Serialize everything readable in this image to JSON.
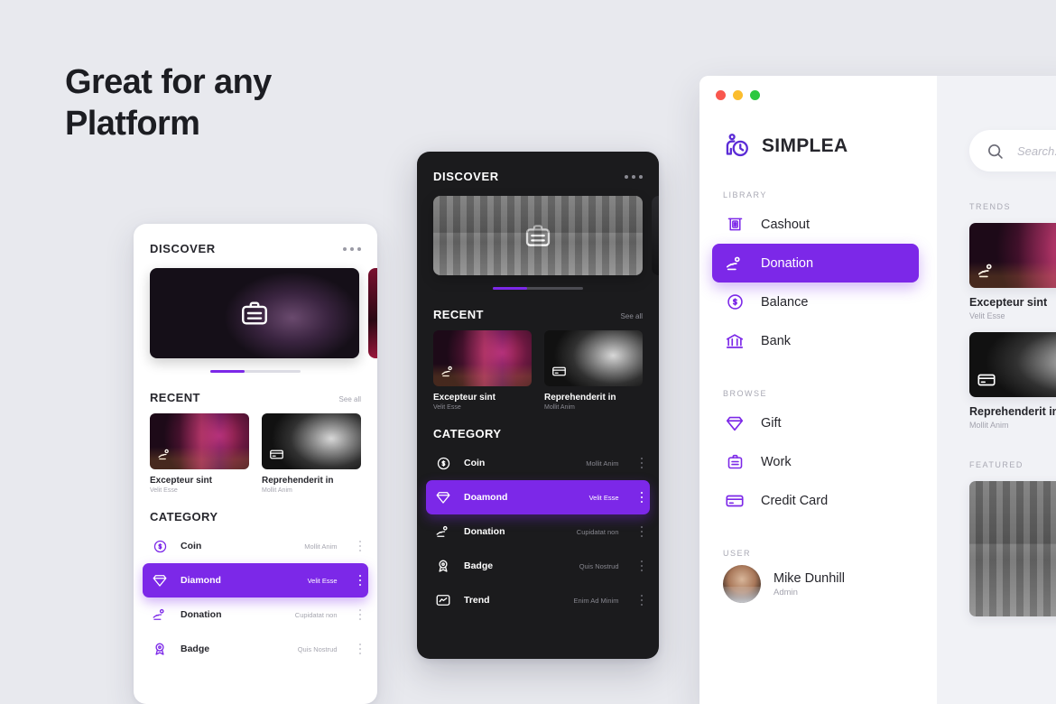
{
  "headline": {
    "line1": "Great for any",
    "line2": "Platform"
  },
  "phone_light": {
    "discover": {
      "title": "DISCOVER",
      "menu_icon": "more-horizontal-icon",
      "hero_icon": "briefcase-icon"
    },
    "recent": {
      "title": "RECENT",
      "see_all": "See all",
      "cards": [
        {
          "title": "Excepteur sint",
          "subtitle": "Velit Esse",
          "icon": "donation-icon"
        },
        {
          "title": "Reprehenderit in",
          "subtitle": "Mollit Anim",
          "icon": "credit-card-icon"
        }
      ]
    },
    "category": {
      "title": "CATEGORY",
      "items": [
        {
          "label": "Coin",
          "meta": "Mollit Anim",
          "icon": "coin-icon",
          "active": false
        },
        {
          "label": "Diamond",
          "meta": "Velit Esse",
          "icon": "diamond-icon",
          "active": true
        },
        {
          "label": "Donation",
          "meta": "Cupidatat non",
          "icon": "donation-icon",
          "active": false
        },
        {
          "label": "Badge",
          "meta": "Quis Nostrud",
          "icon": "badge-icon",
          "active": false
        }
      ]
    }
  },
  "phone_dark": {
    "discover": {
      "title": "DISCOVER",
      "menu_icon": "more-horizontal-icon",
      "hero_icon": "briefcase-icon"
    },
    "recent": {
      "title": "RECENT",
      "see_all": "See all",
      "cards": [
        {
          "title": "Excepteur sint",
          "subtitle": "Velit Esse",
          "icon": "donation-icon"
        },
        {
          "title": "Reprehenderit in",
          "subtitle": "Mollit Anim",
          "icon": "credit-card-icon"
        }
      ]
    },
    "category": {
      "title": "CATEGORY",
      "items": [
        {
          "label": "Coin",
          "meta": "Mollit Anim",
          "icon": "coin-icon",
          "active": false
        },
        {
          "label": "Doamond",
          "meta": "Velit Esse",
          "icon": "diamond-icon",
          "active": true
        },
        {
          "label": "Donation",
          "meta": "Cupidatat non",
          "icon": "donation-icon",
          "active": false
        },
        {
          "label": "Badge",
          "meta": "Quis Nostrud",
          "icon": "badge-icon",
          "active": false
        },
        {
          "label": "Trend",
          "meta": "Enim Ad Minim",
          "icon": "trend-icon",
          "active": false
        }
      ]
    }
  },
  "desktop": {
    "window_controls": {
      "close": "#f9574e",
      "minimize": "#fbbd2e",
      "maximize": "#2cc840"
    },
    "brand": {
      "name": "SIMPLEA",
      "logo_icon": "person-clock-icon"
    },
    "sections": [
      {
        "caption": "LIBRARY",
        "items": [
          {
            "label": "Cashout",
            "icon": "cashout-icon",
            "active": false
          },
          {
            "label": "Donation",
            "icon": "donation-icon",
            "active": true
          },
          {
            "label": "Balance",
            "icon": "coin-icon",
            "active": false
          },
          {
            "label": "Bank",
            "icon": "bank-icon",
            "active": false
          }
        ]
      },
      {
        "caption": "BROWSE",
        "items": [
          {
            "label": "Gift",
            "icon": "diamond-icon",
            "active": false
          },
          {
            "label": "Work",
            "icon": "briefcase-icon",
            "active": false
          },
          {
            "label": "Credit Card",
            "icon": "credit-card-icon",
            "active": false
          }
        ]
      }
    ],
    "user": {
      "caption": "USER",
      "name": "Mike Dunhill",
      "role": "Admin",
      "avatar": "user-avatar"
    },
    "search": {
      "placeholder": "Search...",
      "icon": "search-icon"
    },
    "trends": {
      "caption": "TRENDS",
      "cards": [
        {
          "title": "Excepteur sint",
          "subtitle": "Velit Esse",
          "icon": "donation-icon"
        },
        {
          "title": "Reprehenderit in",
          "subtitle": "Mollit Anim",
          "icon": "credit-card-icon"
        }
      ]
    },
    "featured": {
      "caption": "FEATURED"
    }
  },
  "colors": {
    "accent": "#7c28e8",
    "page_background": "#e8e9ee",
    "pane_background": "#f1f2f6",
    "dark_surface": "#1b1b1d",
    "text_dark": "#26262c",
    "text_muted": "#a2a2ad"
  }
}
